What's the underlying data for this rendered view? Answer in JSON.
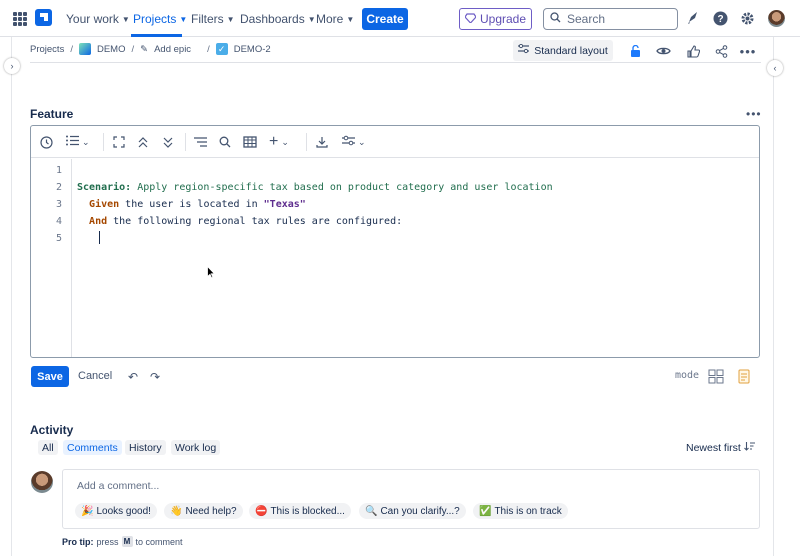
{
  "topnav": {
    "your_work": "Your work",
    "projects": "Projects",
    "filters": "Filters",
    "dashboards": "Dashboards",
    "more": "More",
    "create": "Create",
    "upgrade": "Upgrade",
    "search_placeholder": "Search"
  },
  "breadcrumb": {
    "projects": "Projects",
    "project": "DEMO",
    "add_epic": "Add epic",
    "issue": "DEMO-2"
  },
  "header": {
    "layout_label": "Standard layout"
  },
  "feature": {
    "title": "Feature",
    "line_numbers": [
      "1",
      "2",
      "3",
      "4",
      "5"
    ],
    "line2": {
      "keyword": "Scenario:",
      "text": " Apply region-specific tax based on product category and user location"
    },
    "line3": {
      "indent": "  ",
      "keyword": "Given",
      "text": " the user is located in ",
      "string": "\"Texas\""
    },
    "line4": {
      "indent": "  ",
      "keyword": "And",
      "text": " the following regional tax rules are configured:"
    }
  },
  "editor_actions": {
    "save": "Save",
    "cancel": "Cancel",
    "mode": "mode"
  },
  "activity": {
    "title": "Activity",
    "tabs": [
      "All",
      "Comments",
      "History",
      "Work log"
    ],
    "selected_tab": "Comments",
    "sort": "Newest first",
    "comment_placeholder": "Add a comment...",
    "quick_replies": [
      {
        "emoji": "🎉",
        "label": "Looks good!"
      },
      {
        "emoji": "👋",
        "label": "Need help?"
      },
      {
        "emoji": "⛔",
        "label": "This is blocked..."
      },
      {
        "emoji": "🔍",
        "label": "Can you clarify...?"
      },
      {
        "emoji": "✅",
        "label": "This is on track"
      }
    ],
    "protip_bold": "Pro tip:",
    "protip_press": "press",
    "protip_key": "M",
    "protip_rest": "to comment"
  },
  "colors": {
    "brand_blue": "#0c66e4",
    "upgrade_purple": "#6e5dc6",
    "gherkin_scenario": "#216e4e",
    "gherkin_keyword": "#a54800",
    "gherkin_string": "#5e2d8e"
  }
}
